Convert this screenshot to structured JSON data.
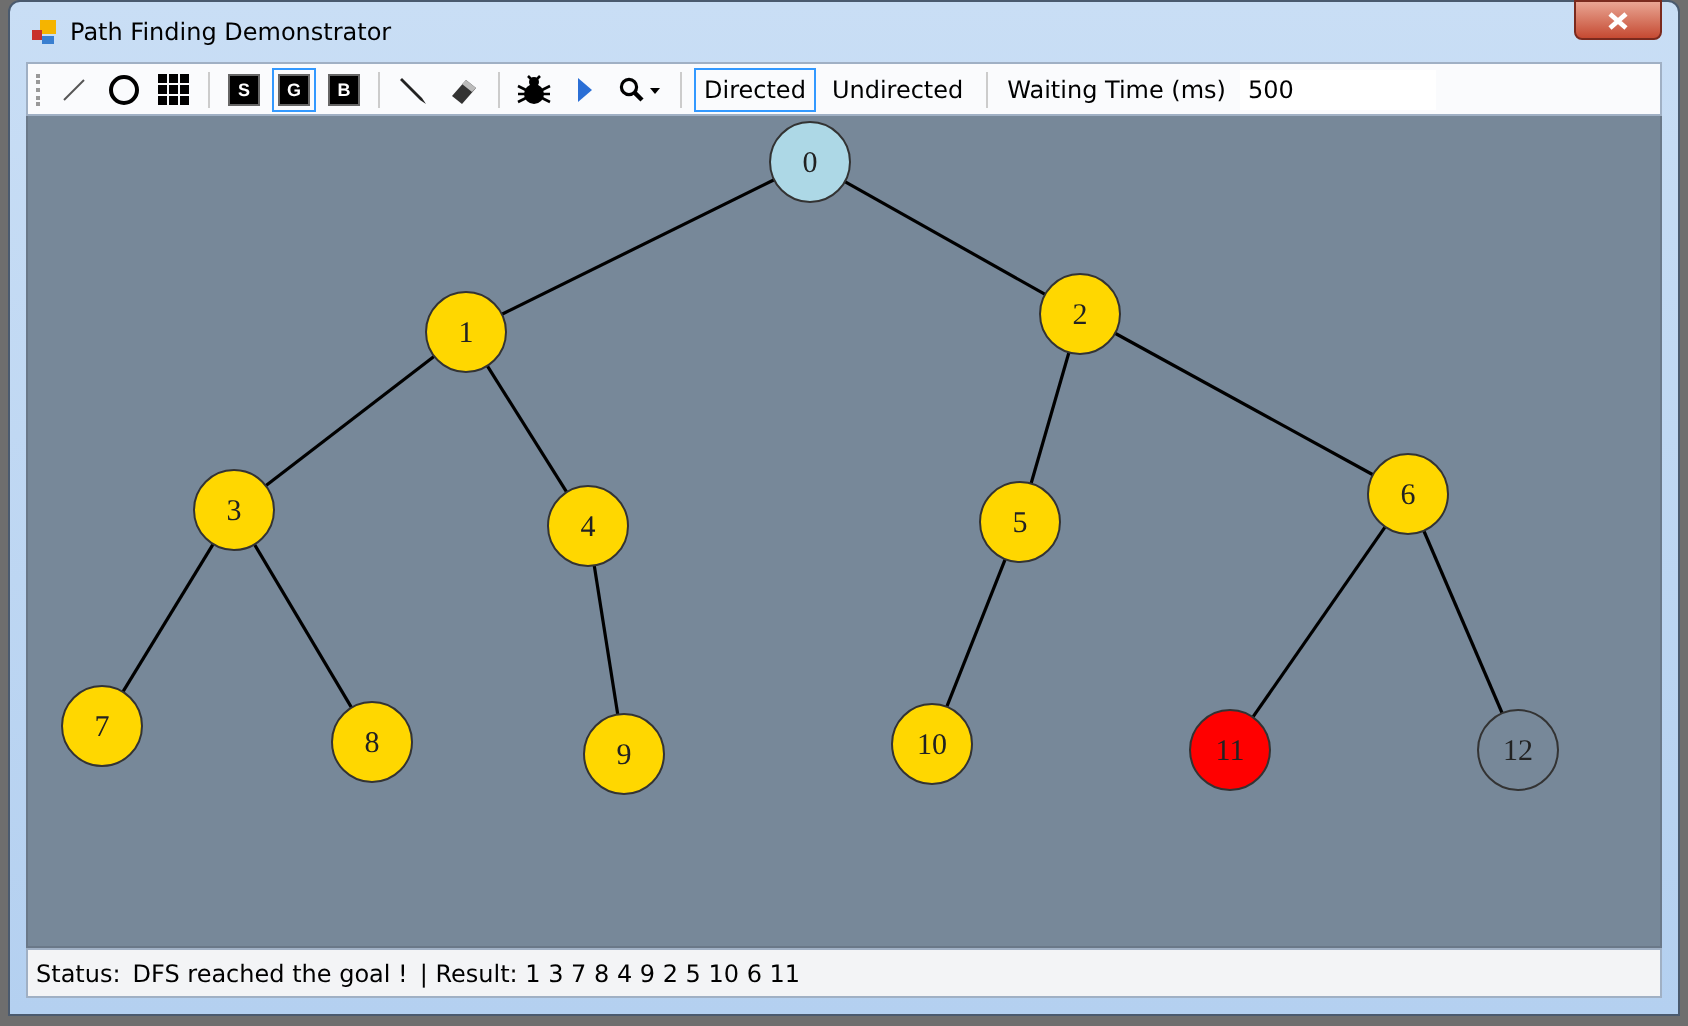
{
  "window": {
    "title": "Path Finding Demonstrator"
  },
  "toolbar": {
    "draw_tools": [
      {
        "kind": "line"
      },
      {
        "kind": "circle"
      },
      {
        "kind": "grid"
      }
    ],
    "node_types": [
      {
        "label": "S",
        "selected": false
      },
      {
        "label": "G",
        "selected": true
      },
      {
        "label": "B",
        "selected": false
      }
    ],
    "edit_tools": [
      {
        "kind": "pencil"
      },
      {
        "kind": "eraser"
      }
    ],
    "run_tools": [
      {
        "kind": "bug"
      },
      {
        "kind": "play"
      },
      {
        "kind": "zoom"
      }
    ],
    "modes": [
      {
        "label": "Directed",
        "selected": true
      },
      {
        "label": "Undirected",
        "selected": false
      }
    ],
    "waiting_time": {
      "label": "Waiting Time (ms)",
      "value": "500"
    }
  },
  "graph": {
    "nodes": [
      {
        "label": "0",
        "color": "#add8e6"
      },
      {
        "label": "1",
        "color": "#ffd700"
      },
      {
        "label": "2",
        "color": "#ffd700"
      },
      {
        "label": "3",
        "color": "#ffd700"
      },
      {
        "label": "4",
        "color": "#ffd700"
      },
      {
        "label": "5",
        "color": "#ffd700"
      },
      {
        "label": "6",
        "color": "#ffd700"
      },
      {
        "label": "7",
        "color": "#ffd700"
      },
      {
        "label": "8",
        "color": "#ffd700"
      },
      {
        "label": "9",
        "color": "#ffd700"
      },
      {
        "label": "10",
        "color": "#ffd700"
      },
      {
        "label": "11",
        "color": "#ff0000"
      },
      {
        "label": "12",
        "color": "#778899"
      }
    ]
  },
  "status_bar": {
    "label": "Status:",
    "message": "DFS reached the goal !",
    "result": "| Result: 1 3 7 8 4 9 2 5 10 6 11"
  }
}
